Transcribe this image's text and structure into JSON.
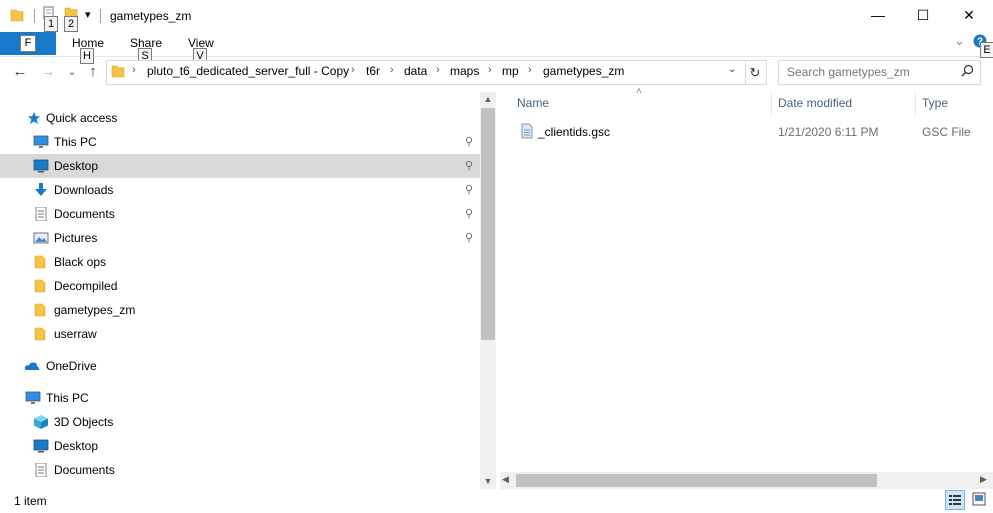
{
  "window": {
    "title": "gametypes_zm",
    "minimize_glyph": "—",
    "maximize_glyph": "☐",
    "close_glyph": "✕"
  },
  "quick_access_toolbar": {
    "keytips": [
      "1",
      "2"
    ],
    "dropdown_glyph": "▾"
  },
  "ribbon": {
    "file_keytip": "F",
    "tabs": [
      {
        "label": "Home",
        "keytip": "H"
      },
      {
        "label": "Share",
        "keytip": "S"
      },
      {
        "label": "View",
        "keytip": "V"
      }
    ],
    "expand_glyph": "⌄",
    "help_keytip": "E"
  },
  "address_bar": {
    "back_glyph": "←",
    "forward_glyph": "→",
    "recent_glyph": "⌄",
    "up_glyph": "↑",
    "breadcrumbs": [
      "pluto_t6_dedicated_server_full - Copy",
      "t6r",
      "data",
      "maps",
      "mp",
      "gametypes_zm"
    ],
    "separator": "›",
    "dropdown_glyph": "⌄",
    "refresh_glyph": "↻"
  },
  "search": {
    "placeholder": "Search gametypes_zm",
    "icon": "magnifier-icon"
  },
  "nav_pane": {
    "quick_access": "Quick access",
    "items": [
      {
        "label": "This PC",
        "pinned": true,
        "icon": "monitor-icon"
      },
      {
        "label": "Desktop",
        "pinned": true,
        "icon": "desktop-icon",
        "selected": true
      },
      {
        "label": "Downloads",
        "pinned": true,
        "icon": "download-icon"
      },
      {
        "label": "Documents",
        "pinned": true,
        "icon": "document-icon"
      },
      {
        "label": "Pictures",
        "pinned": true,
        "icon": "picture-icon"
      },
      {
        "label": "Black ops",
        "pinned": false,
        "icon": "folder-icon"
      },
      {
        "label": "Decompiled",
        "pinned": false,
        "icon": "folder-icon"
      },
      {
        "label": "gametypes_zm",
        "pinned": false,
        "icon": "folder-icon"
      },
      {
        "label": "userraw",
        "pinned": false,
        "icon": "folder-icon"
      }
    ],
    "onedrive": "OneDrive",
    "this_pc": "This PC",
    "pc_items": [
      {
        "label": "3D Objects",
        "icon": "cube-icon"
      },
      {
        "label": "Desktop",
        "icon": "desktop-icon"
      },
      {
        "label": "Documents",
        "icon": "document-icon"
      }
    ],
    "pin_glyph": "📌",
    "scroll_up": "▲",
    "scroll_down": "▼"
  },
  "content": {
    "columns": [
      "Name",
      "Date modified",
      "Type"
    ],
    "sort_glyph": "˄",
    "files": [
      {
        "name": "_clientids.gsc",
        "date_modified": "1/21/2020 6:11 PM",
        "type": "GSC File"
      }
    ],
    "hscroll_left": "◀",
    "hscroll_right": "▶"
  },
  "status_bar": {
    "item_count": "1 item"
  },
  "colors": {
    "accent": "#1979ca",
    "selection": "#d9d9d9",
    "folder": "#f5c348",
    "column_header": "#4c607a"
  }
}
